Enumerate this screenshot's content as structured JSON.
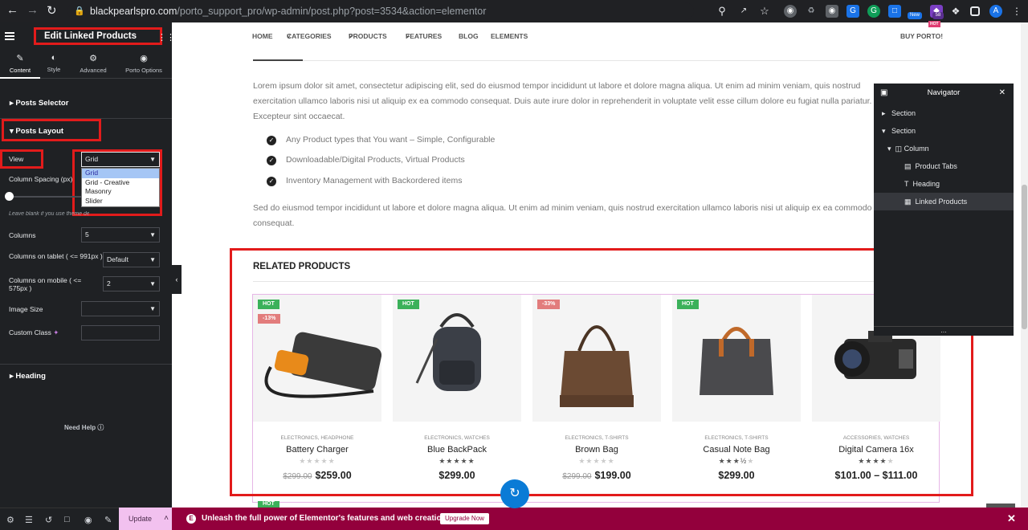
{
  "browser": {
    "url_host": "blackpearlspro.com",
    "url_path": "/porto_support_pro/wp-admin/post.php?post=3534&action=elementor",
    "ext_badge_new": "New",
    "ext_badge_count": "58",
    "profile_initial": "A",
    "colors": {
      "bar": "#202124"
    }
  },
  "panel": {
    "title": "Edit Linked Products",
    "tabs": [
      {
        "label": "Content",
        "icon": "pencil-icon"
      },
      {
        "label": "Style",
        "icon": "contrast-icon"
      },
      {
        "label": "Advanced",
        "icon": "gear-icon"
      },
      {
        "label": "Porto Options",
        "icon": "circle-dot-icon"
      }
    ],
    "sections": {
      "posts_selector": "Posts Selector",
      "posts_layout": "Posts Layout",
      "heading": "Heading"
    },
    "view_label": "View",
    "view_value": "Grid",
    "view_options": [
      "Grid",
      "Grid - Creative",
      "Masonry",
      "Slider"
    ],
    "column_spacing_label": "Column Spacing (px)",
    "leave_blank": "Leave blank if you use theme default value.",
    "columns_label": "Columns",
    "columns_value": "5",
    "columns_tablet_label": "Columns on tablet ( <= 991px )",
    "columns_tablet_value": "Default",
    "columns_mobile_label": "Columns on mobile ( <= 575px )",
    "columns_mobile_value": "2",
    "image_size_label": "Image Size",
    "image_size_value": "",
    "custom_class_label": "Custom Class",
    "custom_class_value": "",
    "need_help": "Need Help",
    "update_label": "Update"
  },
  "banner": {
    "text": "Unleash the full power of Elementor's features and web creation tools.",
    "button": "Upgrade Now"
  },
  "site": {
    "nav": [
      "HOME",
      "CATEGORIES",
      "PRODUCTS",
      "FEATURES",
      "BLOG",
      "ELEMENTS"
    ],
    "buy": "BUY PORTO!",
    "buy_badge": "HOT",
    "para1": "Lorem ipsum dolor sit amet, consectetur adipiscing elit, sed do eiusmod tempor incididunt ut labore et dolore magna aliqua. Ut enim ad minim veniam, quis nostrud exercitation ullamco laboris nisi ut aliquip ex ea commodo consequat. Duis aute irure dolor in reprehenderit in voluptate velit esse cillum dolore eu fugiat nulla pariatur. Excepteur sint occaecat.",
    "bullets": [
      "Any Product types that You want – Simple, Configurable",
      "Downloadable/Digital Products, Virtual Products",
      "Inventory Management with Backordered items"
    ],
    "para2": "Sed do eiusmod tempor incididunt ut labore et dolore magna aliqua. Ut enim ad minim veniam, quis nostrud exercitation ullamco laboris nisi ut aliquip ex ea commodo consequat.",
    "related_title": "RELATED PRODUCTS",
    "next_row_badge": "HOT"
  },
  "products": [
    {
      "badges": [
        "HOT",
        "-13%"
      ],
      "cats": "ELECTRONICS, HEADPHONE",
      "name": "Battery Charger",
      "old_price": "$299.00",
      "price": "$259.00",
      "rating": 0
    },
    {
      "badges": [
        "HOT"
      ],
      "cats": "ELECTRONICS, WATCHES",
      "name": "Blue BackPack",
      "old_price": "",
      "price": "$299.00",
      "rating": 5
    },
    {
      "badges": [
        "-33%"
      ],
      "cats": "ELECTRONICS, T-SHIRTS",
      "name": "Brown Bag",
      "old_price": "$299.00",
      "price": "$199.00",
      "rating": 0
    },
    {
      "badges": [
        "HOT"
      ],
      "cats": "ELECTRONICS, T-SHIRTS",
      "name": "Casual Note Bag",
      "old_price": "",
      "price": "$299.00",
      "rating": 3.5
    },
    {
      "badges": [],
      "cats": "ACCESSORIES, WATCHES",
      "name": "Digital Camera 16x",
      "old_price": "",
      "price": "$101.00 – $111.00",
      "rating": 4
    }
  ],
  "navigator": {
    "title": "Navigator",
    "items": [
      {
        "label": "Section",
        "icon": "caret-right-icon"
      },
      {
        "label": "Section",
        "icon": "caret-down-icon"
      },
      {
        "label": "Column",
        "icon": "column-icon"
      },
      {
        "label": "Product Tabs",
        "icon": "tabs-icon"
      },
      {
        "label": "Heading",
        "icon": "heading-icon"
      },
      {
        "label": "Linked Products",
        "icon": "products-icon"
      }
    ],
    "footer": "..."
  },
  "colors": {
    "hot": "#3bb15a",
    "sale": "#e27c7c",
    "highlight": "#e21b1b",
    "banner": "#93003c"
  }
}
